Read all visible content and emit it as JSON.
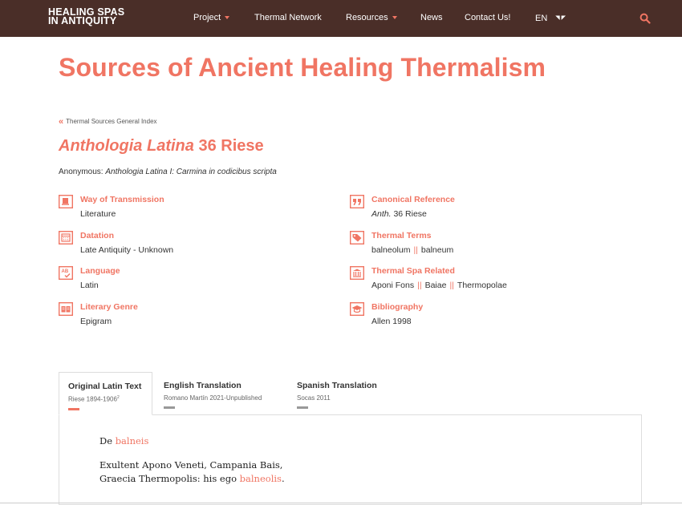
{
  "nav": {
    "logo_line1": "HEALING SPAS",
    "logo_line2": "IN ANTIQUITY",
    "items": [
      {
        "label": "Project",
        "dropdown": true
      },
      {
        "label": "Thermal Network",
        "dropdown": false
      },
      {
        "label": "Resources",
        "dropdown": true
      },
      {
        "label": "News",
        "dropdown": false
      },
      {
        "label": "Contact Us!",
        "dropdown": false
      }
    ],
    "language": "EN",
    "search_icon": "search-icon"
  },
  "page_title": "Sources of Ancient Healing Thermalism",
  "back_link": "Thermal Sources General Index",
  "work": {
    "title_italic": "Anthologia Latina",
    "title_rest": "36 Riese",
    "author_prefix": "Anonymous:",
    "author_work": "Anthologia Latina I: Carmina in codicibus scripta"
  },
  "info_left": [
    {
      "icon": "scroll-icon",
      "label": "Way of Transmission",
      "value": "Literature"
    },
    {
      "icon": "calendar-icon",
      "label": "Datation",
      "value": "Late Antiquity - Unknown"
    },
    {
      "icon": "language-icon",
      "label": "Language",
      "value": "Latin"
    },
    {
      "icon": "book-icon",
      "label": "Literary Genre",
      "value": "Epigram"
    }
  ],
  "info_right": {
    "canonical": {
      "icon": "quote-icon",
      "label": "Canonical Reference",
      "value_italic": "Anth.",
      "value_rest": "36 Riese"
    },
    "terms": {
      "icon": "tag-icon",
      "label": "Thermal Terms",
      "values": [
        "balneolum",
        "balneum"
      ]
    },
    "spa": {
      "icon": "building-icon",
      "label": "Thermal Spa Related",
      "values": [
        "Aponi Fons",
        "Baiae",
        "Thermopolae"
      ]
    },
    "biblio": {
      "icon": "graduation-cap-icon",
      "label": "Bibliography",
      "value": "Allen 1998"
    }
  },
  "separator": "||",
  "tabs": [
    {
      "label": "Original Latin Text",
      "sub": "Riese 1894-1906",
      "sup": "2",
      "active": true
    },
    {
      "label": "English Translation",
      "sub": "Romano Martín 2021-Unpublished",
      "sup": "",
      "active": false
    },
    {
      "label": "Spanish Translation",
      "sub": "Socas 2011",
      "sup": "",
      "active": false
    }
  ],
  "text": {
    "heading_prefix": "De",
    "heading_term": "balneis",
    "line1": "Exultent Apono Veneti, Campania Bais,",
    "line2_prefix": "Graecia Thermopolis: his ego",
    "line2_term": "balneolis",
    "line2_suffix": "."
  },
  "colors": {
    "accent": "#f07563",
    "navbar": "#4a2e28",
    "text": "#333333"
  }
}
